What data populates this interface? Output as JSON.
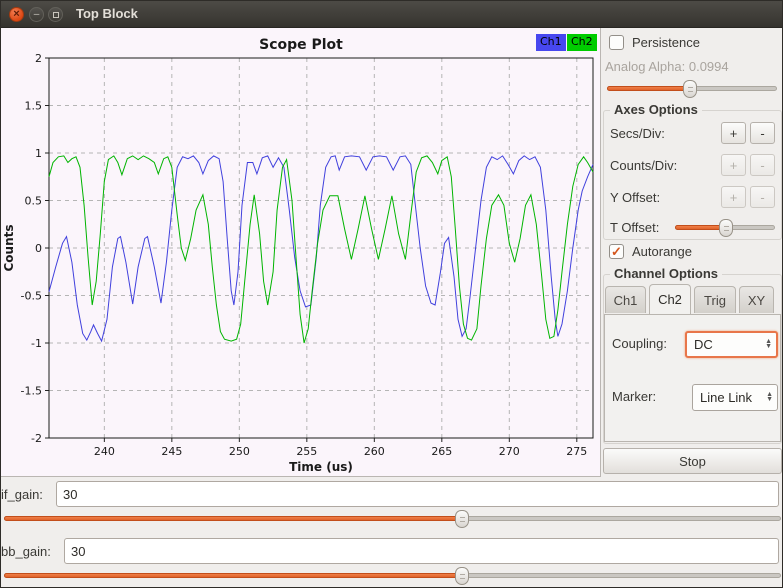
{
  "window": {
    "title": "Top Block"
  },
  "figure": {
    "legend": [
      {
        "label": "Ch1",
        "color": "#4747ef"
      },
      {
        "label": "Ch2",
        "color": "#00cc00"
      }
    ]
  },
  "chart_data": {
    "type": "line",
    "title": "Scope Plot",
    "xlabel": "Time (us)",
    "ylabel": "Counts",
    "xlim": [
      235.9,
      276.2
    ],
    "ylim": [
      -2,
      2
    ],
    "xticks": [
      240,
      245,
      250,
      255,
      260,
      265,
      270,
      275
    ],
    "yticks": [
      2,
      1.5,
      1,
      0.5,
      0,
      -0.5,
      -1,
      -1.5,
      -2
    ],
    "grid": true,
    "legend_position": "top-right",
    "series": [
      {
        "name": "Ch1",
        "color": "#4040dd",
        "points": [
          [
            235.9,
            -0.46
          ],
          [
            236.4,
            -0.2
          ],
          [
            236.9,
            0.05
          ],
          [
            237.2,
            0.12
          ],
          [
            237.6,
            -0.15
          ],
          [
            238.0,
            -0.6
          ],
          [
            238.4,
            -0.9
          ],
          [
            238.7,
            -0.97
          ],
          [
            239.0,
            -0.88
          ],
          [
            239.2,
            -0.81
          ],
          [
            239.5,
            -0.9
          ],
          [
            239.8,
            -0.98
          ],
          [
            240.2,
            -0.75
          ],
          [
            240.6,
            -0.2
          ],
          [
            241.0,
            0.1
          ],
          [
            241.2,
            0.12
          ],
          [
            241.6,
            -0.15
          ],
          [
            242.1,
            -0.59
          ],
          [
            242.5,
            -0.2
          ],
          [
            243.0,
            0.1
          ],
          [
            243.2,
            0.12
          ],
          [
            243.7,
            -0.2
          ],
          [
            244.2,
            -0.58
          ],
          [
            244.6,
            -0.15
          ],
          [
            245.0,
            0.4
          ],
          [
            245.4,
            0.85
          ],
          [
            245.8,
            0.96
          ],
          [
            246.2,
            0.94
          ],
          [
            246.6,
            0.97
          ],
          [
            247.0,
            0.9
          ],
          [
            247.3,
            0.78
          ],
          [
            247.7,
            0.92
          ],
          [
            248.1,
            0.97
          ],
          [
            248.5,
            0.94
          ],
          [
            248.8,
            0.7
          ],
          [
            249.1,
            0.1
          ],
          [
            249.4,
            -0.45
          ],
          [
            249.6,
            -0.6
          ],
          [
            249.9,
            -0.25
          ],
          [
            250.2,
            0.45
          ],
          [
            250.6,
            0.9
          ],
          [
            251.0,
            0.9
          ],
          [
            251.3,
            0.78
          ],
          [
            251.7,
            0.95
          ],
          [
            252.1,
            0.97
          ],
          [
            252.5,
            0.85
          ],
          [
            252.9,
            0.95
          ],
          [
            253.3,
            0.85
          ],
          [
            253.7,
            0.4
          ],
          [
            254.1,
            -0.1
          ],
          [
            254.5,
            -0.45
          ],
          [
            254.9,
            -0.62
          ],
          [
            255.3,
            -0.6
          ],
          [
            255.7,
            -0.1
          ],
          [
            256.0,
            0.45
          ],
          [
            256.4,
            0.85
          ],
          [
            256.8,
            0.96
          ],
          [
            257.1,
            0.97
          ],
          [
            257.4,
            0.82
          ],
          [
            257.8,
            0.96
          ],
          [
            258.3,
            0.97
          ],
          [
            258.9,
            0.96
          ],
          [
            259.4,
            0.82
          ],
          [
            259.9,
            0.96
          ],
          [
            260.4,
            0.97
          ],
          [
            260.9,
            0.96
          ],
          [
            261.4,
            0.82
          ],
          [
            261.9,
            0.96
          ],
          [
            262.3,
            0.97
          ],
          [
            262.7,
            0.88
          ],
          [
            263.0,
            0.5
          ],
          [
            263.4,
            0.0
          ],
          [
            263.8,
            -0.4
          ],
          [
            264.2,
            -0.58
          ],
          [
            264.5,
            -0.6
          ],
          [
            264.9,
            -0.25
          ],
          [
            265.2,
            0.05
          ],
          [
            265.5,
            0.11
          ],
          [
            265.9,
            -0.3
          ],
          [
            266.2,
            -0.75
          ],
          [
            266.5,
            -0.93
          ],
          [
            266.8,
            -0.85
          ],
          [
            267.1,
            -0.5
          ],
          [
            267.5,
            0.0
          ],
          [
            267.9,
            0.5
          ],
          [
            268.3,
            0.85
          ],
          [
            268.7,
            0.96
          ],
          [
            269.1,
            0.93
          ],
          [
            269.5,
            0.97
          ],
          [
            269.9,
            0.88
          ],
          [
            270.3,
            0.78
          ],
          [
            270.7,
            0.92
          ],
          [
            271.1,
            0.97
          ],
          [
            271.5,
            0.93
          ],
          [
            271.9,
            0.96
          ],
          [
            272.3,
            0.85
          ],
          [
            272.7,
            0.4
          ],
          [
            273.1,
            -0.3
          ],
          [
            273.4,
            -0.75
          ],
          [
            273.6,
            -0.93
          ],
          [
            273.9,
            -0.8
          ],
          [
            274.3,
            -0.45
          ],
          [
            274.7,
            0.0
          ],
          [
            275.1,
            0.4
          ],
          [
            275.4,
            0.6
          ],
          [
            275.8,
            0.75
          ],
          [
            276.2,
            0.88
          ]
        ]
      },
      {
        "name": "Ch2",
        "color": "#00b400",
        "points": [
          [
            235.9,
            0.75
          ],
          [
            236.2,
            0.9
          ],
          [
            236.6,
            0.96
          ],
          [
            237.0,
            0.97
          ],
          [
            237.3,
            0.9
          ],
          [
            237.6,
            0.94
          ],
          [
            237.9,
            0.96
          ],
          [
            238.2,
            0.85
          ],
          [
            238.5,
            0.45
          ],
          [
            238.8,
            -0.1
          ],
          [
            239.1,
            -0.6
          ],
          [
            239.4,
            -0.35
          ],
          [
            239.7,
            0.15
          ],
          [
            240.0,
            0.7
          ],
          [
            240.3,
            0.93
          ],
          [
            240.7,
            0.97
          ],
          [
            241.0,
            0.9
          ],
          [
            241.3,
            0.77
          ],
          [
            241.7,
            0.94
          ],
          [
            242.1,
            0.97
          ],
          [
            242.5,
            0.93
          ],
          [
            242.9,
            0.97
          ],
          [
            243.3,
            0.94
          ],
          [
            243.7,
            0.9
          ],
          [
            244.0,
            0.78
          ],
          [
            244.4,
            0.94
          ],
          [
            244.7,
            0.96
          ],
          [
            245.0,
            0.85
          ],
          [
            245.4,
            0.35
          ],
          [
            245.7,
            0.0
          ],
          [
            246.0,
            -0.13
          ],
          [
            246.4,
            0.1
          ],
          [
            246.8,
            0.4
          ],
          [
            247.3,
            0.56
          ],
          [
            247.7,
            0.25
          ],
          [
            248.0,
            -0.2
          ],
          [
            248.3,
            -0.6
          ],
          [
            248.6,
            -0.88
          ],
          [
            248.9,
            -0.96
          ],
          [
            249.4,
            -0.98
          ],
          [
            249.8,
            -0.96
          ],
          [
            250.1,
            -0.8
          ],
          [
            250.4,
            -0.35
          ],
          [
            250.8,
            0.25
          ],
          [
            251.1,
            0.56
          ],
          [
            251.5,
            0.15
          ],
          [
            251.8,
            -0.35
          ],
          [
            252.1,
            -0.6
          ],
          [
            252.5,
            -0.25
          ],
          [
            252.8,
            0.4
          ],
          [
            253.2,
            0.85
          ],
          [
            253.5,
            0.93
          ],
          [
            253.9,
            0.5
          ],
          [
            254.2,
            -0.1
          ],
          [
            254.5,
            -0.7
          ],
          [
            254.8,
            -1.0
          ],
          [
            255.1,
            -0.85
          ],
          [
            255.4,
            -0.45
          ],
          [
            255.8,
            0.05
          ],
          [
            256.2,
            0.4
          ],
          [
            256.7,
            0.55
          ],
          [
            257.3,
            0.55
          ],
          [
            257.8,
            0.2
          ],
          [
            258.3,
            -0.12
          ],
          [
            258.8,
            0.2
          ],
          [
            259.3,
            0.55
          ],
          [
            259.8,
            0.2
          ],
          [
            260.3,
            -0.12
          ],
          [
            260.8,
            0.2
          ],
          [
            261.3,
            0.55
          ],
          [
            261.8,
            0.15
          ],
          [
            262.3,
            -0.12
          ],
          [
            262.7,
            0.35
          ],
          [
            263.1,
            0.8
          ],
          [
            263.5,
            0.95
          ],
          [
            263.9,
            0.97
          ],
          [
            264.3,
            0.9
          ],
          [
            264.7,
            0.78
          ],
          [
            265.0,
            0.92
          ],
          [
            265.4,
            0.96
          ],
          [
            265.7,
            0.75
          ],
          [
            266.0,
            0.2
          ],
          [
            266.3,
            -0.4
          ],
          [
            266.6,
            -0.8
          ],
          [
            266.9,
            -0.95
          ],
          [
            267.2,
            -0.97
          ],
          [
            267.6,
            -0.85
          ],
          [
            267.9,
            -0.4
          ],
          [
            268.3,
            0.1
          ],
          [
            268.7,
            0.45
          ],
          [
            269.2,
            0.56
          ],
          [
            269.6,
            0.45
          ],
          [
            270.0,
            0.05
          ],
          [
            270.4,
            -0.15
          ],
          [
            270.8,
            0.1
          ],
          [
            271.2,
            0.45
          ],
          [
            271.6,
            0.56
          ],
          [
            272.0,
            0.25
          ],
          [
            272.4,
            -0.3
          ],
          [
            272.7,
            -0.75
          ],
          [
            273.0,
            -0.95
          ],
          [
            273.3,
            -0.93
          ],
          [
            273.6,
            -0.65
          ],
          [
            273.9,
            -0.25
          ],
          [
            274.3,
            0.25
          ],
          [
            274.7,
            0.65
          ],
          [
            275.1,
            0.88
          ],
          [
            275.5,
            0.96
          ],
          [
            275.8,
            0.9
          ],
          [
            276.2,
            0.8
          ]
        ]
      }
    ]
  },
  "panel": {
    "persistence_label": "Persistence",
    "persistence_checked": false,
    "analog_alpha_label": "Analog Alpha: 0.0994",
    "autorange_label": "Autorange",
    "autorange_checked": true,
    "autorange_check_glyph": "✓",
    "axes_options": {
      "title": "Axes Options",
      "secs_div_label": "Secs/Div:",
      "counts_div_label": "Counts/Div:",
      "y_offset_label": "Y Offset:",
      "t_offset_label": "T Offset:",
      "plus": "+",
      "minus": "-"
    },
    "channel_options": {
      "title": "Channel Options",
      "tabs": [
        "Ch1",
        "Ch2",
        "Trig",
        "XY"
      ],
      "active_tab": "Ch2",
      "coupling_label": "Coupling:",
      "coupling_value": "DC",
      "marker_label": "Marker:",
      "marker_value": "Line Link",
      "spin_up": "▲",
      "spin_down": "▼"
    },
    "stop_label": "Stop"
  },
  "sliders": {
    "analog_alpha": {
      "percent": 49
    },
    "t_offset": {
      "percent": 51
    },
    "if_gain": {
      "percent": 59
    },
    "bb_gain": {
      "percent": 59
    }
  },
  "variables": {
    "if_gain": {
      "label": "if_gain:",
      "value": "30"
    },
    "bb_gain": {
      "label": "bb_gain:",
      "value": "30"
    }
  }
}
